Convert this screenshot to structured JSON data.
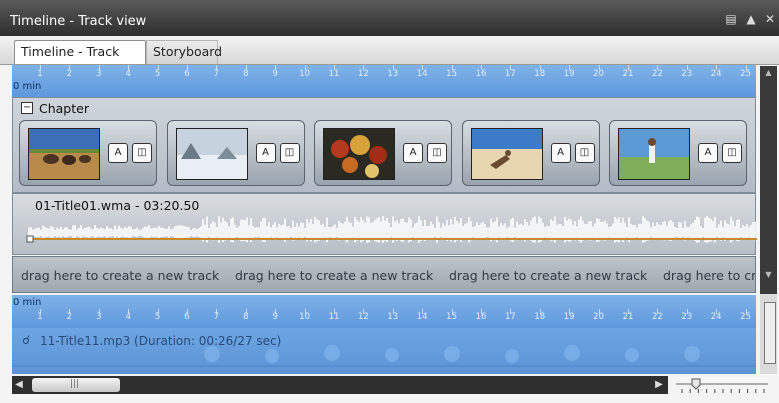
{
  "window": {
    "title": "Timeline - Track view"
  },
  "tabs": [
    {
      "label": "Timeline - Track view",
      "active": true
    },
    {
      "label": "Storyboard",
      "active": false
    }
  ],
  "ruler": {
    "start_label": "0 min",
    "ticks": [
      "1",
      "2",
      "3",
      "4",
      "5",
      "6",
      "7",
      "8",
      "9",
      "10",
      "11",
      "12",
      "13",
      "14",
      "15",
      "16",
      "17",
      "18",
      "19",
      "20",
      "21",
      "22",
      "23",
      "24",
      "25"
    ]
  },
  "chapter": {
    "label": "Chapter",
    "clips": [
      {
        "scene": "elephants-savanna"
      },
      {
        "scene": "snowy-landscape"
      },
      {
        "scene": "autumn-leaves"
      },
      {
        "scene": "beach-person"
      },
      {
        "scene": "person-grass"
      }
    ]
  },
  "audio_track": {
    "label": "01-Title01.wma - 03:20.50"
  },
  "drag_hint": "drag here to create a new track",
  "bottom_ruler": {
    "start_label": "0 min"
  },
  "music_track": {
    "label": "11-Title11.mp3 (Duration: 00:26/27 sec)"
  },
  "colors": {
    "ruler_blue": "#6aa2e2",
    "titlebar": "#3d3d3d",
    "waveform": "#ffffff",
    "waveform_line": "#c98a2a"
  }
}
